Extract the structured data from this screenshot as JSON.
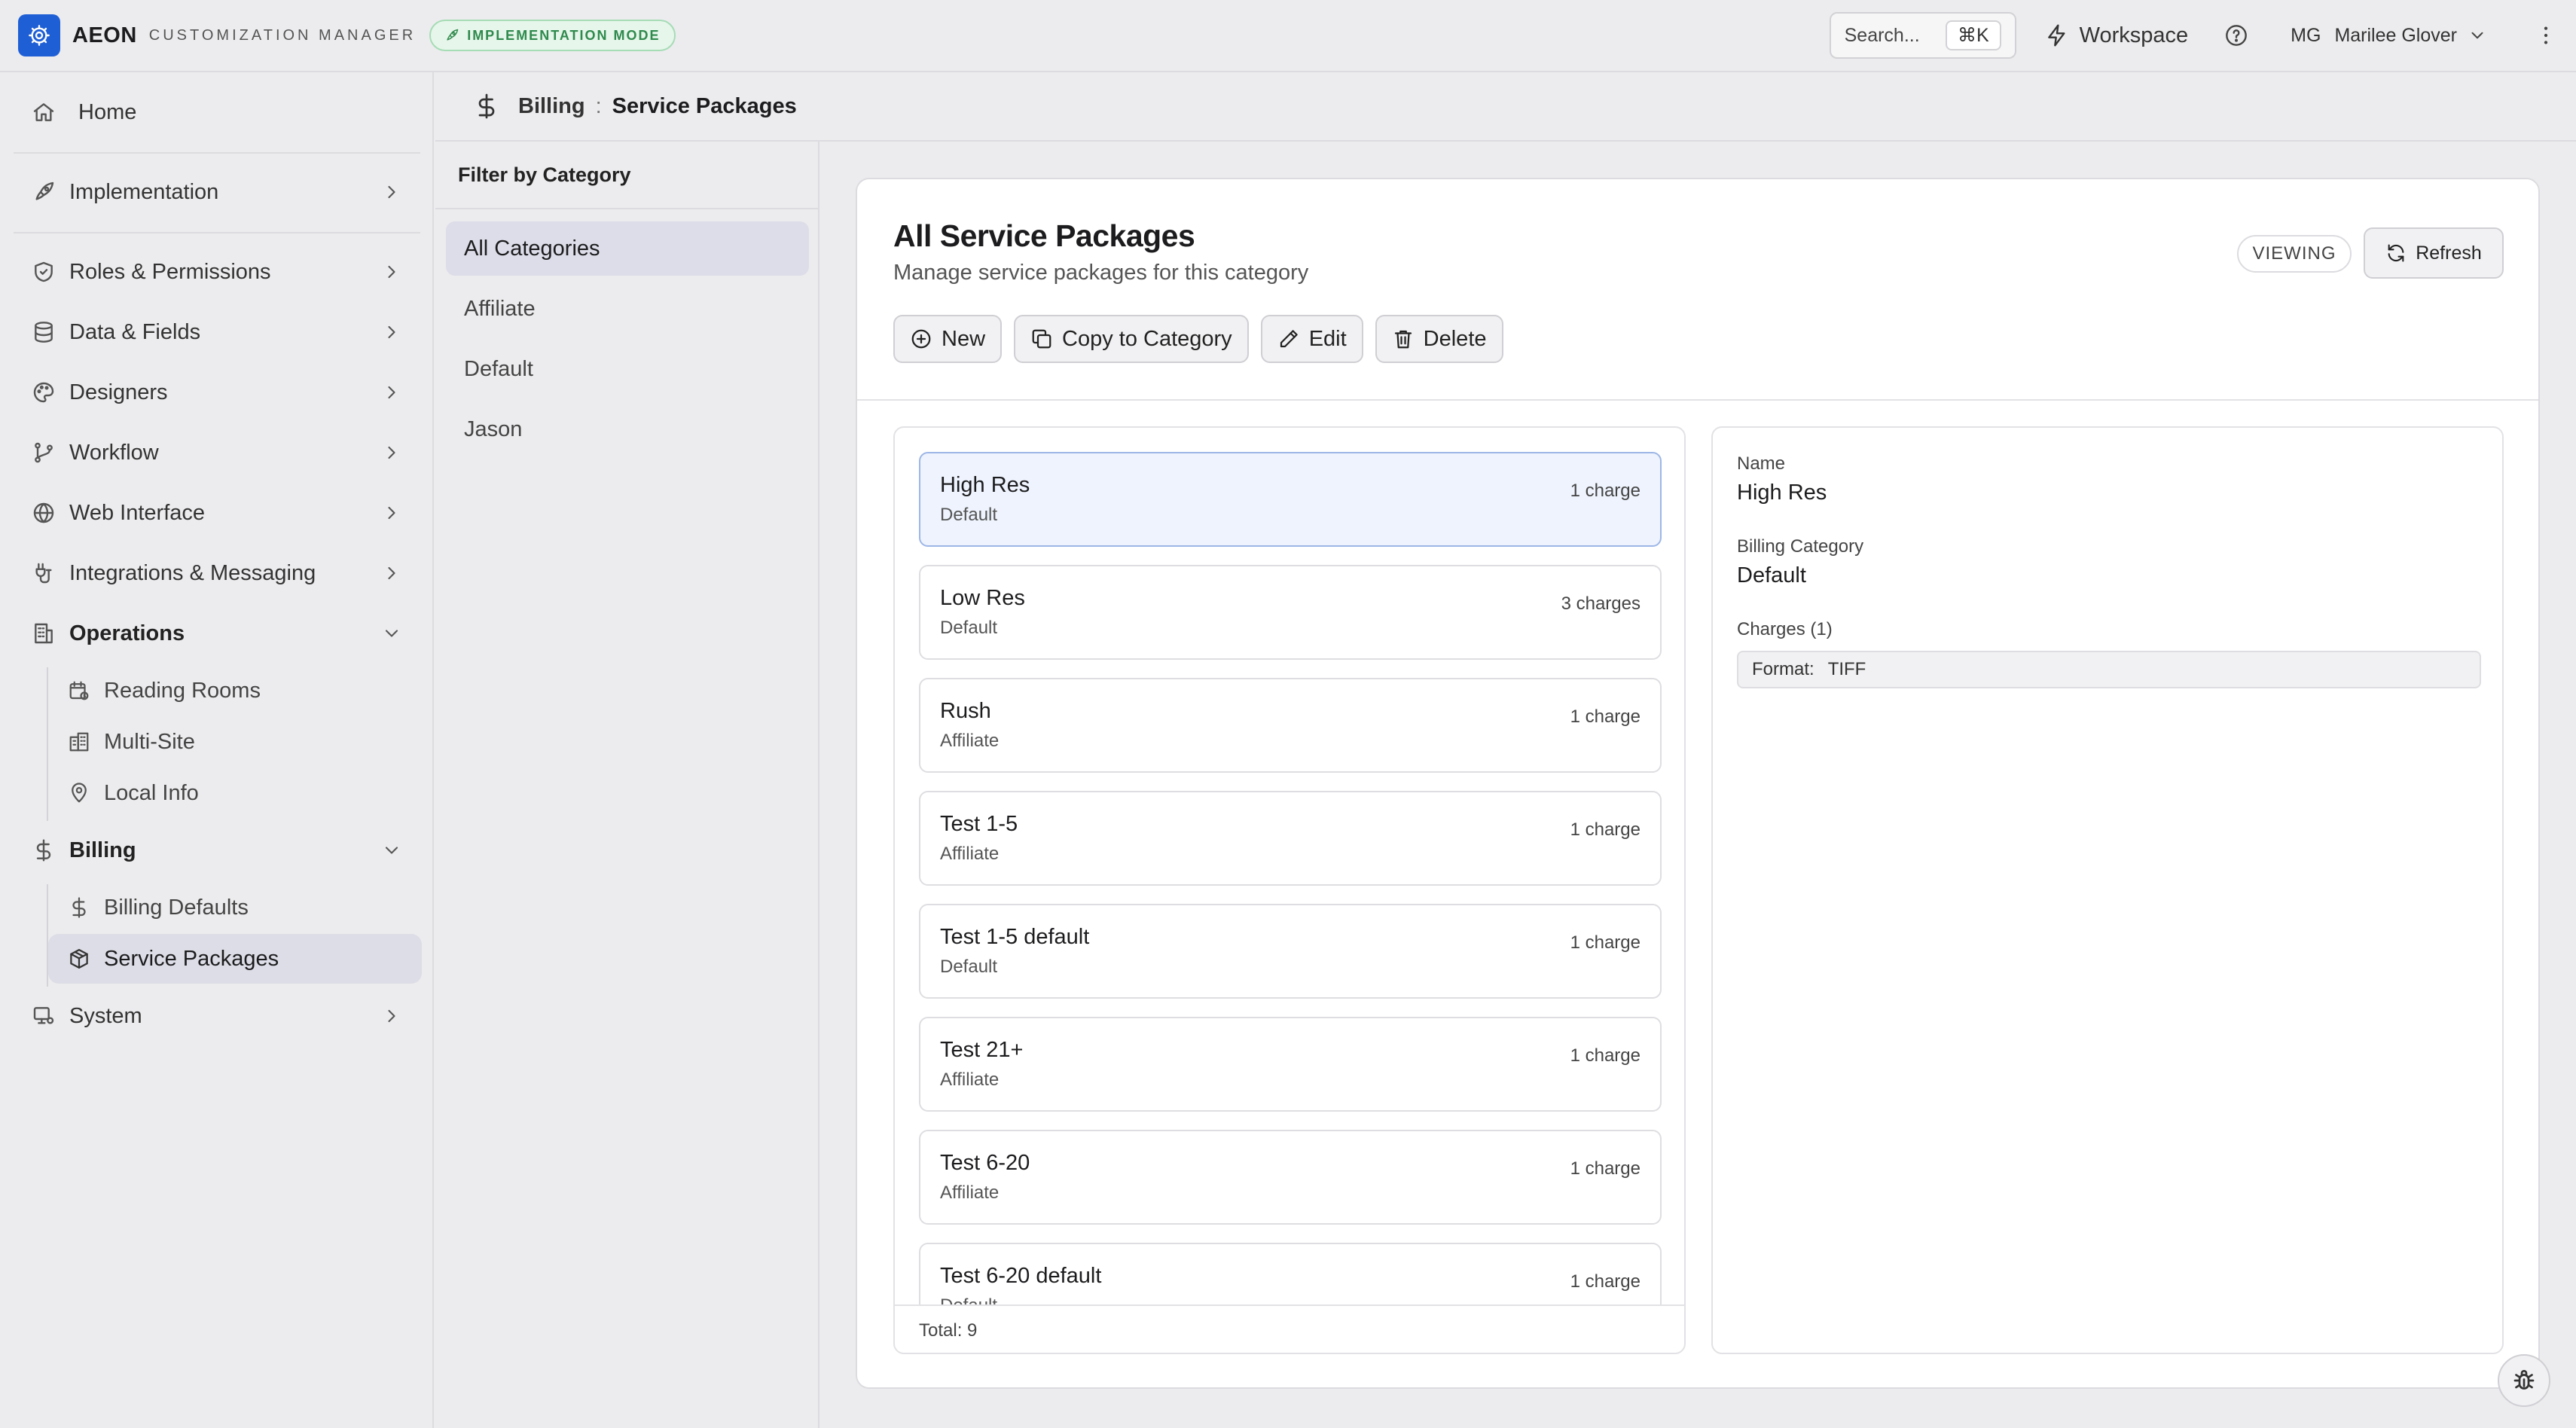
{
  "app": {
    "brand": "AEON",
    "subtitle": "CUSTOMIZATION MANAGER",
    "mode_badge": "IMPLEMENTATION MODE",
    "accent": "#1f5fd6"
  },
  "topbar": {
    "search_label": "Search...",
    "search_shortcut": "⌘K",
    "workspace_label": "Workspace",
    "user_initials": "MG",
    "user_name": "Marilee Glover"
  },
  "sidebar": {
    "home": "Home",
    "implementation": "Implementation",
    "roles": "Roles & Permissions",
    "data_fields": "Data & Fields",
    "designers": "Designers",
    "workflow": "Workflow",
    "web_interface": "Web Interface",
    "integrations": "Integrations & Messaging",
    "operations": "Operations",
    "operations_items": [
      "Reading Rooms",
      "Multi-Site",
      "Local Info"
    ],
    "billing": "Billing",
    "billing_items": [
      "Billing Defaults",
      "Service Packages"
    ],
    "system": "System",
    "active_item": "Service Packages"
  },
  "breadcrumb": {
    "section": "Billing",
    "separator": ":",
    "page": "Service Packages"
  },
  "filter": {
    "title": "Filter by Category",
    "items": [
      "All Categories",
      "Affiliate",
      "Default",
      "Jason"
    ],
    "active": "All Categories"
  },
  "main": {
    "title": "All Service Packages",
    "description": "Manage service packages for this category",
    "status_pill": "VIEWING",
    "refresh_label": "Refresh",
    "actions": {
      "new": "New",
      "copy": "Copy to Category",
      "edit": "Edit",
      "delete": "Delete"
    }
  },
  "packages": {
    "items": [
      {
        "name": "High Res",
        "category": "Default",
        "charges": "1 charge"
      },
      {
        "name": "Low Res",
        "category": "Default",
        "charges": "3 charges"
      },
      {
        "name": "Rush",
        "category": "Affiliate",
        "charges": "1 charge"
      },
      {
        "name": "Test 1-5",
        "category": "Affiliate",
        "charges": "1 charge"
      },
      {
        "name": "Test 1-5 default",
        "category": "Default",
        "charges": "1 charge"
      },
      {
        "name": "Test 21+",
        "category": "Affiliate",
        "charges": "1 charge"
      },
      {
        "name": "Test 6-20",
        "category": "Affiliate",
        "charges": "1 charge"
      },
      {
        "name": "Test 6-20 default",
        "category": "Default",
        "charges": "1 charge"
      }
    ],
    "selected": "High Res",
    "total_label": "Total: 9"
  },
  "detail": {
    "name_label": "Name",
    "name_value": "High Res",
    "category_label": "Billing Category",
    "category_value": "Default",
    "charges_label": "Charges (1)",
    "charge_key": "Format:",
    "charge_value": "TIFF"
  }
}
